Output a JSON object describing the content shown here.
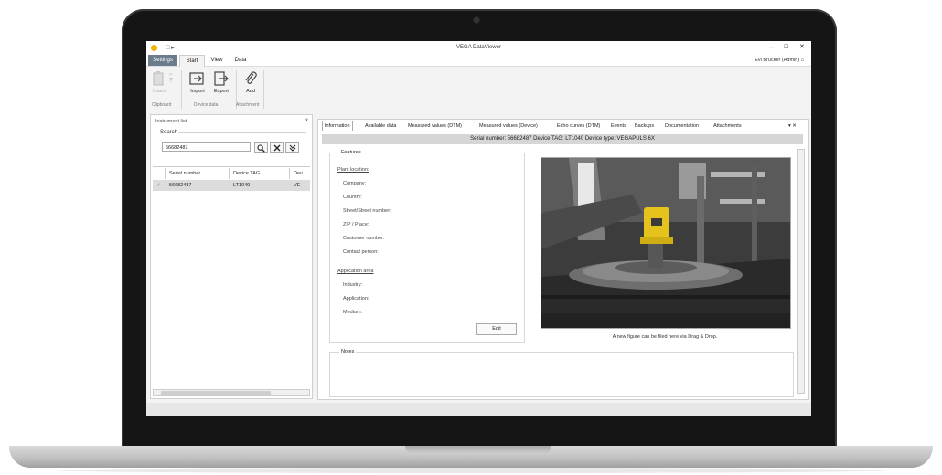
{
  "window": {
    "title": "VEGA DataViewer",
    "user": "Evi Brucker (Admin)",
    "qa_label": "□ ▸",
    "buttons": {
      "minimize": "–",
      "maximize": "☐",
      "close": "✕"
    }
  },
  "ribbon": {
    "tabs": [
      "Settings",
      "Start",
      "View",
      "Data"
    ],
    "buttons": {
      "insert": "Insert",
      "import": "Import",
      "export": "Export",
      "add": "Add"
    },
    "groups": {
      "clipboard": "Clipboard",
      "device_data": "Device data",
      "attachment": "Attachment"
    }
  },
  "instrument_list": {
    "title": "Instrument list",
    "close": "x",
    "search_label": "Search",
    "search_value": "56682487",
    "search_btn_icons": [
      "search-icon",
      "clear-icon",
      "expand-icon"
    ],
    "columns": [
      "Serial number",
      "Device TAG",
      "Dev"
    ],
    "rows": [
      {
        "check": "✓",
        "serial": "56682487",
        "tag": "LT1040",
        "dev": "VE"
      }
    ]
  },
  "details": {
    "tabs": [
      "Information",
      "Available data",
      "Measured values (DTM)",
      "Measured values (Device)",
      "Echo curves (DTM)",
      "Events",
      "Backups",
      "Documentation",
      "Attachments"
    ],
    "tab_controls": "▾ ✕",
    "infobar": "Serial number: 56682487   Device TAG: LT1040   Device type: VEGAPULS 6X",
    "features_title": "Features",
    "plant_location": "Plant location:",
    "company": "Company:",
    "country": "Country:",
    "street": "Street/Street number:",
    "zip": "ZIP / Place:",
    "customer": "Customer number:",
    "contact": "Contact person:",
    "application_area": "Application area",
    "industry": "Industry:",
    "application": "Application:",
    "medium": "Medium:",
    "edit": "Edit",
    "caption": "A new figure can be filed here via Drag & Drop.",
    "notes_title": "Notes"
  }
}
